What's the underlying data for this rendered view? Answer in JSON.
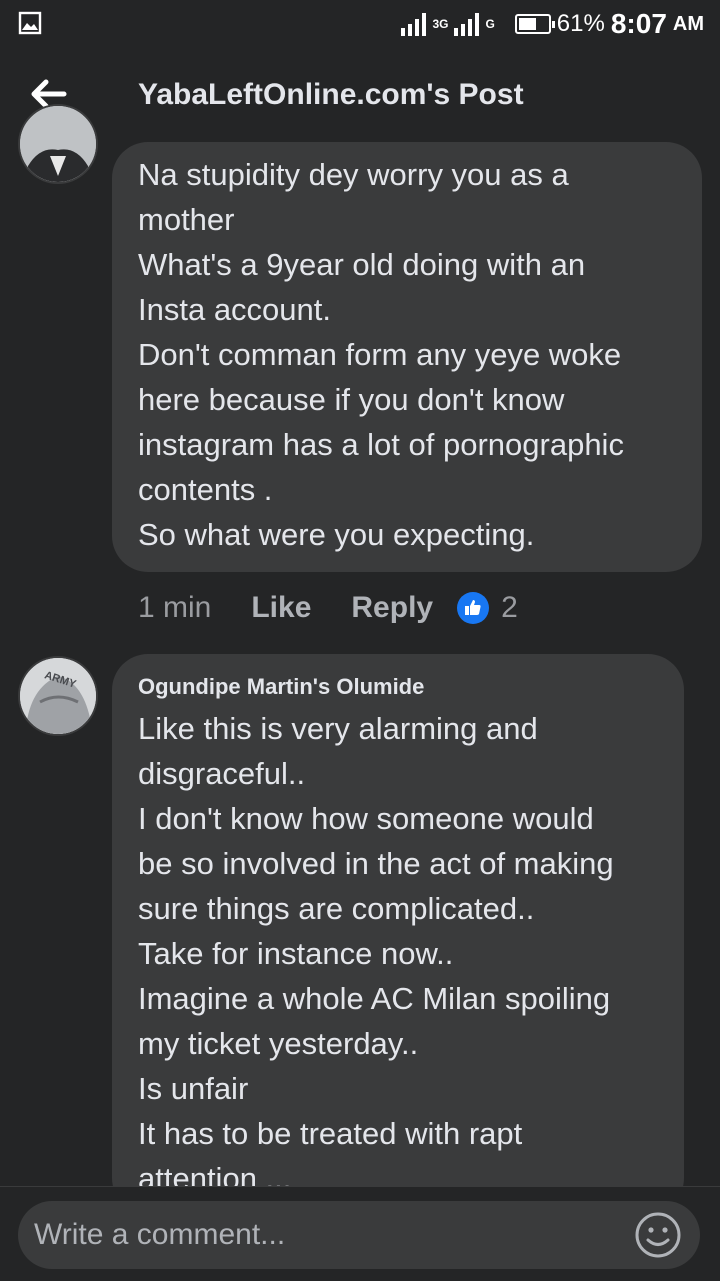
{
  "status_bar": {
    "network_type": "3G",
    "second_network": "G",
    "battery_percent": "61%",
    "battery_level": 0.61,
    "time": "8:07",
    "ampm": "AM"
  },
  "header": {
    "title": "YabaLeftOnline.com's Post"
  },
  "comments": [
    {
      "lines": [
        "Na stupidity dey worry you as a",
        "mother",
        "What's a 9year old doing with an",
        "Insta account.",
        "Don't comman form any yeye woke",
        "here because if you don't know",
        "instagram has a lot of pornographic",
        "contents .",
        "So what were you expecting."
      ],
      "time": "1 min",
      "like_label": "Like",
      "reply_label": "Reply",
      "reaction_count": "2"
    },
    {
      "author": "Ogundipe Martin's Olumide",
      "avatar_text": "ARMY",
      "lines": [
        "Like this is very alarming and",
        "disgraceful..",
        "I don't know how someone would",
        "be so involved in the act of making",
        "sure things are complicated..",
        "Take for instance now..",
        "Imagine a whole AC Milan spoiling",
        "my ticket yesterday..",
        "Is unfair",
        "It has to be treated with rapt",
        "attention ..."
      ]
    }
  ],
  "composer": {
    "placeholder": "Write a comment..."
  },
  "colors": {
    "background": "#242526",
    "bubble": "#3a3b3c",
    "text": "#e4e6eb",
    "muted": "#b0b3b8",
    "accent": "#1877f2"
  }
}
